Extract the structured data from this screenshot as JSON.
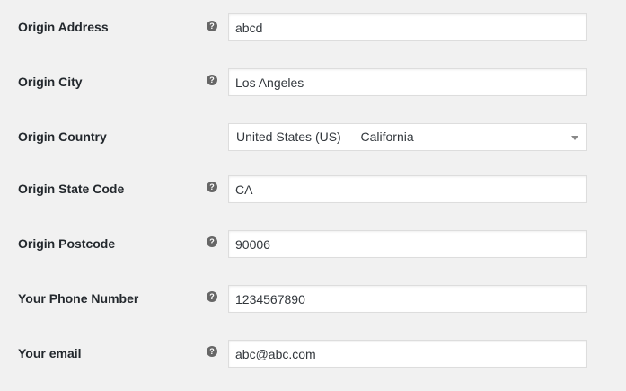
{
  "form": {
    "origin_address": {
      "label": "Origin Address",
      "value": "abcd"
    },
    "origin_city": {
      "label": "Origin City",
      "value": "Los Angeles"
    },
    "origin_country": {
      "label": "Origin Country",
      "selected": "United States (US) — California"
    },
    "origin_state_code": {
      "label": "Origin State Code",
      "value": "CA"
    },
    "origin_postcode": {
      "label": "Origin Postcode",
      "value": "90006"
    },
    "phone_number": {
      "label": "Your Phone Number",
      "value": "1234567890"
    },
    "email": {
      "label": "Your email",
      "value": "abc@abc.com"
    }
  },
  "icons": {
    "help": "question-mark-circle"
  },
  "help_glyph": "?"
}
